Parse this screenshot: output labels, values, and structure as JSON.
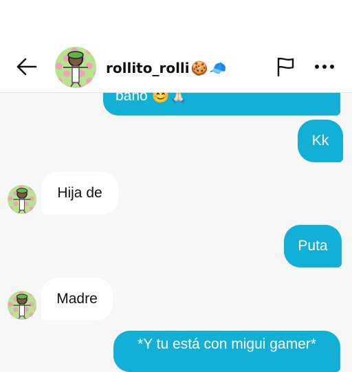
{
  "header": {
    "username": "rollito_rolli",
    "username_emojis": [
      "🍪",
      "🧢"
    ]
  },
  "icons": {
    "back": "arrow-left-icon",
    "report": "flag-icon",
    "more": "more-horizontal-icon"
  },
  "messages": [
    {
      "direction": "sent",
      "text": "baño 😊🙏🏻"
    },
    {
      "direction": "sent",
      "text": "Kk"
    },
    {
      "direction": "received",
      "text": "Hija de"
    },
    {
      "direction": "sent",
      "text": "Puta"
    },
    {
      "direction": "received",
      "text": "Madre"
    },
    {
      "direction": "sent",
      "text": "*Y tu está con migui gamer*"
    }
  ],
  "colors": {
    "sent_bubble": "#12afd6",
    "received_bubble": "#ffffff",
    "background": "#f7f7f7"
  }
}
